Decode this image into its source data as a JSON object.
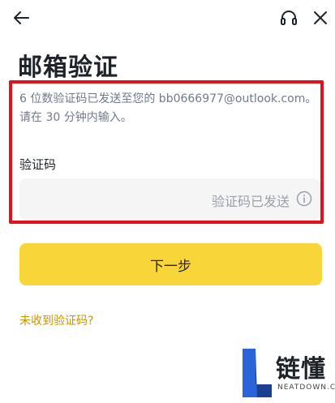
{
  "header": {
    "back_icon": "arrow-left-icon",
    "support_icon": "headset-icon",
    "close_icon": "close-icon"
  },
  "page": {
    "title": "邮箱验证"
  },
  "verification": {
    "description": "6 位数验证码已发送至您的 bb0666977@outlook.com。请在 30 分钟内输入。",
    "code_label": "验证码",
    "input_status": "验证码已发送",
    "info_icon": "info-icon"
  },
  "actions": {
    "next_label": "下一步",
    "resend_link": "未收到验证码?"
  },
  "watermark": {
    "text": "链懂",
    "subtext": "NEATDOWN.COM"
  },
  "colors": {
    "accent": "#f8d538",
    "link": "#c99400",
    "highlight_border": "#e4101a"
  }
}
